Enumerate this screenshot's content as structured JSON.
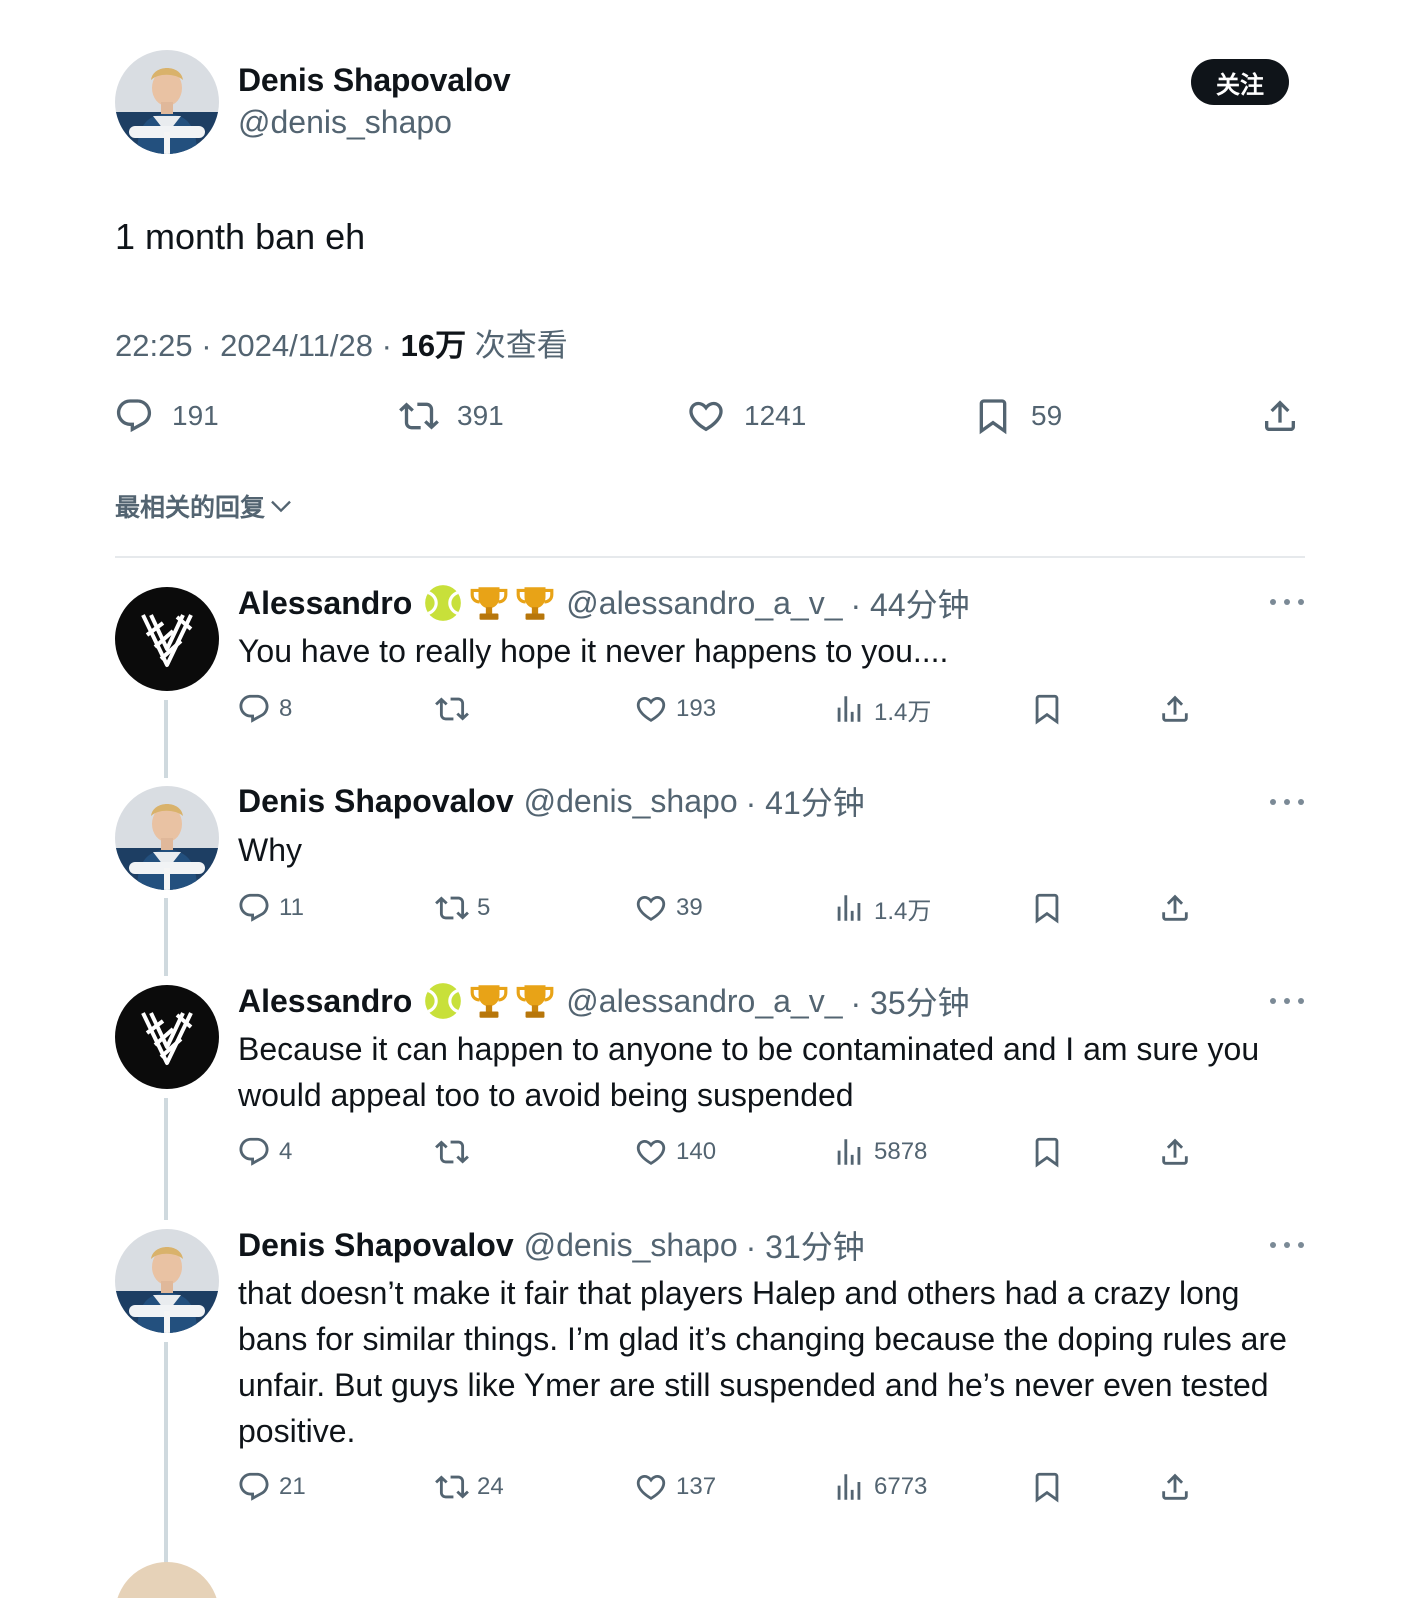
{
  "main_tweet": {
    "author_name": "Denis Shapovalov",
    "author_handle": "@denis_shapo",
    "follow_label": "关注",
    "text": "1 month ban eh",
    "time": "22:25",
    "date": "2024/11/28",
    "separator": "·",
    "views_count": "16万",
    "views_label": "次查看",
    "stats": {
      "replies": "191",
      "retweets": "391",
      "likes": "1241",
      "bookmarks": "59"
    }
  },
  "sort_label": "最相关的回复",
  "replies": [
    {
      "name": "Alessandro",
      "badges": [
        "tennis-ball-emoji",
        "trophy-emoji",
        "trophy-emoji"
      ],
      "handle": "@alessandro_a_v_",
      "time": "· 44分钟",
      "text": "You have to really hope it never happens to you....",
      "replies": "8",
      "retweets": "",
      "likes": "193",
      "views": "1.4万"
    },
    {
      "name": "Denis Shapovalov",
      "badges": [],
      "handle": "@denis_shapo",
      "time": "· 41分钟",
      "text": "Why",
      "replies": "11",
      "retweets": "5",
      "likes": "39",
      "views": "1.4万"
    },
    {
      "name": "Alessandro",
      "badges": [
        "tennis-ball-emoji",
        "trophy-emoji",
        "trophy-emoji"
      ],
      "handle": "@alessandro_a_v_",
      "time": "· 35分钟",
      "text": "Because it can happen to anyone to be contaminated and I am sure you would appeal too to avoid being suspended",
      "replies": "4",
      "retweets": "",
      "likes": "140",
      "views": "5878"
    },
    {
      "name": "Denis Shapovalov",
      "badges": [],
      "handle": "@denis_shapo",
      "time": "· 31分钟",
      "text": "that doesn’t make it fair that players Halep and others had a crazy long bans for similar things. I’m glad it’s changing because the doping rules are unfair. But guys like Ymer are still suspended and he’s never even tested positive.",
      "replies": "21",
      "retweets": "24",
      "likes": "137",
      "views": "6773"
    }
  ],
  "icons": {
    "reply": "reply-icon",
    "retweet": "retweet-icon",
    "like": "heart-icon",
    "views": "views-icon",
    "bookmark": "bookmark-icon",
    "share": "share-icon",
    "more": "more-icon"
  },
  "colors": {
    "text": "#0f1419",
    "secondary": "#536471",
    "divider": "#e6e9ec",
    "follow_button": "#0f1419"
  }
}
